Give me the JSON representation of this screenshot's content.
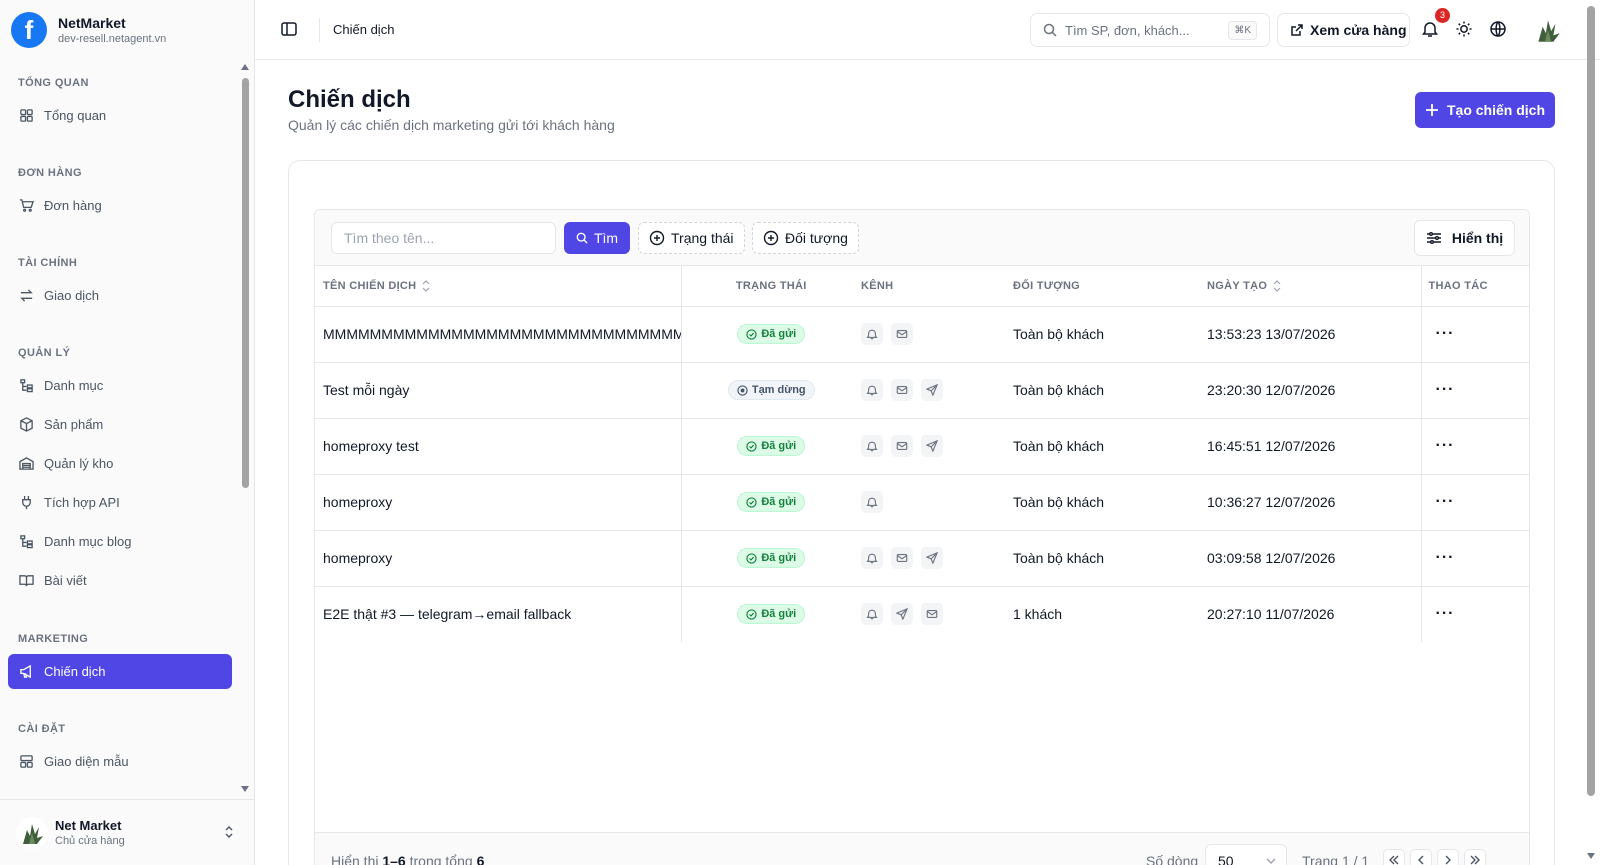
{
  "brand": {
    "name": "NetMarket",
    "domain": "dev-resell.netagent.vn",
    "logo_letter": "f"
  },
  "sidebar": {
    "sections": [
      {
        "title": "TỔNG QUAN",
        "items": [
          {
            "label": "Tổng quan",
            "icon": "grid-icon"
          }
        ]
      },
      {
        "title": "ĐƠN HÀNG",
        "items": [
          {
            "label": "Đơn hàng",
            "icon": "cart-icon"
          }
        ]
      },
      {
        "title": "TÀI CHÍNH",
        "items": [
          {
            "label": "Giao dịch",
            "icon": "arrows-icon"
          }
        ]
      },
      {
        "title": "QUẢN LÝ",
        "items": [
          {
            "label": "Danh mục",
            "icon": "tree-icon"
          },
          {
            "label": "Sản phẩm",
            "icon": "box-icon"
          },
          {
            "label": "Quản lý kho",
            "icon": "warehouse-icon"
          },
          {
            "label": "Tích hợp API",
            "icon": "plug-icon"
          },
          {
            "label": "Danh mục blog",
            "icon": "tree-icon"
          },
          {
            "label": "Bài viết",
            "icon": "book-icon"
          }
        ]
      },
      {
        "title": "MARKETING",
        "items": [
          {
            "label": "Chiến dịch",
            "icon": "megaphone-icon",
            "active": true
          }
        ]
      },
      {
        "title": "CÀI ĐẶT",
        "items": [
          {
            "label": "Giao diện mẫu",
            "icon": "layout-icon"
          }
        ]
      }
    ],
    "footer": {
      "name": "Net Market",
      "role": "Chủ cửa hàng"
    }
  },
  "header": {
    "breadcrumb": "Chiến dịch",
    "search_placeholder": "Tìm SP, đơn, khách...",
    "search_shortcut": "⌘K",
    "store_button": "Xem cửa hàng",
    "notification_count": "3"
  },
  "page": {
    "title": "Chiến dịch",
    "subtitle": "Quản lý các chiến dịch marketing gửi tới khách hàng",
    "create_button": "Tạo chiến dịch"
  },
  "toolbar": {
    "search_placeholder": "Tìm theo tên...",
    "search_button": "Tìm",
    "filter_status": "Trạng thái",
    "filter_audience": "Đối tượng",
    "view_button": "Hiển thị"
  },
  "table": {
    "headers": {
      "name": "TÊN CHIẾN DỊCH",
      "status": "TRẠNG THÁI",
      "channel": "KÊNH",
      "target": "ĐỐI TƯỢNG",
      "date": "NGÀY TẠO",
      "action": "THAO TÁC"
    },
    "rows": [
      {
        "name": "MMMMMMMMMMMMMMMMMMMMMMMMMMMMMMMMMMMM",
        "status": "Đã gửi",
        "status_type": "sent",
        "channels": [
          "bell-icon",
          "mail-icon"
        ],
        "target": "Toàn bộ khách",
        "date": "13:53:23 13/07/2026"
      },
      {
        "name": "Test mỗi ngày",
        "status": "Tạm dừng",
        "status_type": "paused",
        "channels": [
          "bell-icon",
          "mail-icon",
          "send-icon"
        ],
        "target": "Toàn bộ khách",
        "date": "23:20:30 12/07/2026"
      },
      {
        "name": "homeproxy test",
        "status": "Đã gửi",
        "status_type": "sent",
        "channels": [
          "bell-icon",
          "mail-icon",
          "send-icon"
        ],
        "target": "Toàn bộ khách",
        "date": "16:45:51 12/07/2026"
      },
      {
        "name": "homeproxy",
        "status": "Đã gửi",
        "status_type": "sent",
        "channels": [
          "bell-icon"
        ],
        "target": "Toàn bộ khách",
        "date": "10:36:27 12/07/2026"
      },
      {
        "name": "homeproxy",
        "status": "Đã gửi",
        "status_type": "sent",
        "channels": [
          "bell-icon",
          "mail-icon",
          "send-icon"
        ],
        "target": "Toàn bộ khách",
        "date": "03:09:58 12/07/2026"
      },
      {
        "name": "E2E thật #3 — telegram→email fallback",
        "status": "Đã gửi",
        "status_type": "sent",
        "channels": [
          "bell-icon",
          "send-icon",
          "mail-icon"
        ],
        "target": "1 khách",
        "date": "20:27:10 11/07/2026"
      }
    ],
    "action_label": "···"
  },
  "pager": {
    "prefix": "Hiển thị",
    "range": "1–6",
    "middle": "trong tổng",
    "total": "6",
    "rows_label": "Số dòng",
    "rows_value": "50",
    "page_label": "Trang 1 / 1"
  },
  "colors": {
    "accent": "#4f46e5",
    "sent_bg": "#dcfce7",
    "sent_fg": "#15803d",
    "brand": "#1877f2"
  }
}
